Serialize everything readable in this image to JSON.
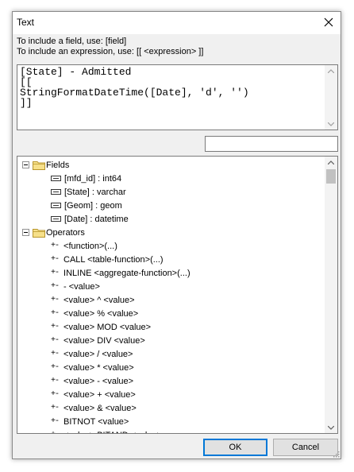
{
  "window": {
    "title": "Text"
  },
  "hints": {
    "field": "To include a field, use: [field]",
    "expression": "To include an expression, use: [[ <expression> ]]"
  },
  "expression": {
    "lines": [
      "[State] - Admitted",
      "[[",
      "StringFormatDateTime([Date], 'd', '')",
      "]]"
    ]
  },
  "search": {
    "value": ""
  },
  "tree": {
    "fields_label": "Fields",
    "fields": [
      "[mfd_id] : int64",
      "[State] : varchar",
      "[Geom] : geom",
      "[Date] : datetime"
    ],
    "operators_label": "Operators",
    "operators": [
      "<function>(...)",
      "CALL <table-function>(...)",
      "INLINE <aggregate-function>(...)",
      "- <value>",
      "<value> ^ <value>",
      "<value> % <value>",
      "<value> MOD <value>",
      "<value> DIV <value>",
      "<value> / <value>",
      "<value> * <value>",
      "<value> - <value>",
      "<value> + <value>",
      "<value> & <value>",
      "BITNOT <value>",
      "<value> BITAND <value>"
    ],
    "operator_icon": "+-"
  },
  "buttons": {
    "ok": "OK",
    "cancel": "Cancel"
  }
}
